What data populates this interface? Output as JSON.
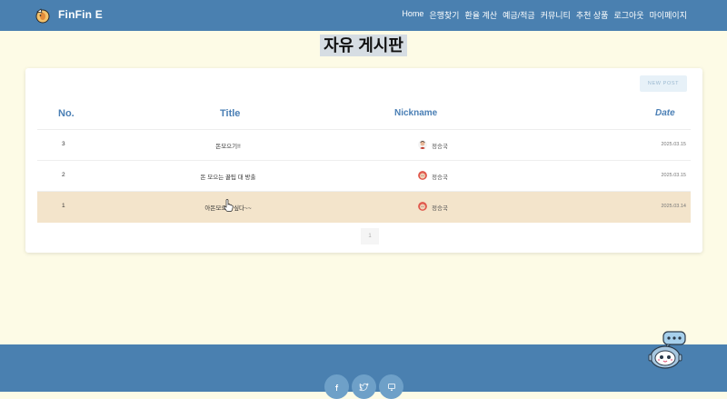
{
  "header": {
    "brand": "FinFin E",
    "nav": [
      "Home",
      "은행찾기",
      "환율 계산",
      "예금/적금",
      "커뮤니티",
      "추천 상품",
      "로그아웃",
      "마이페이지"
    ]
  },
  "page": {
    "title": "자유 게시판"
  },
  "board": {
    "new_post_label": "NEW POST",
    "columns": {
      "no": "No.",
      "title": "Title",
      "nickname": "Nickname",
      "date": "Date"
    },
    "rows": [
      {
        "no": "3",
        "title": "돈모으기!!",
        "nickname": "정승국",
        "date": "2025.03.15"
      },
      {
        "no": "2",
        "title": "돈 모으는 꿀팁 대 방출",
        "nickname": "정승국",
        "date": "2025.03.15"
      },
      {
        "no": "1",
        "title": "아돈모으고 싶다~~",
        "nickname": "정승국",
        "date": "2025.03.14"
      }
    ],
    "pagination": {
      "current_page": "1"
    }
  },
  "footer": {
    "social_icons": [
      "facebook-icon",
      "twitter-icon",
      "monitor-icon"
    ]
  },
  "chatbot": {
    "icon": "robot-chat-icon"
  },
  "colors": {
    "primary": "#4a80b0",
    "page_bg": "#fdfbe6",
    "header_text": "#4a7fb5",
    "highlight_row": "#f3e4cb"
  }
}
